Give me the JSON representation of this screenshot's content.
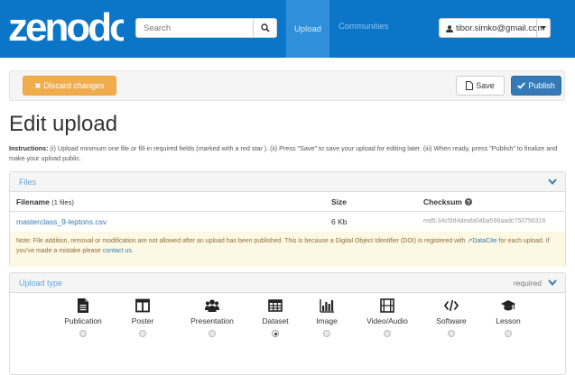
{
  "navbar": {
    "logo_text": "zenodo",
    "search_placeholder": "Search",
    "upload_label": "Upload",
    "communities_label": "Communities",
    "user_email": "tibor.simko@gmail.com"
  },
  "actions": {
    "discard_label": "Discard changes",
    "save_label": "Save",
    "publish_label": "Publish"
  },
  "page": {
    "title": "Edit upload",
    "instructions_label": "Instructions:",
    "instructions_text": " (i) Upload minimum one file or fill-in required fields (marked with a red star ). (ii) Press \"Save\" to save your upload for editing later. (iii) When ready, press \"Publish\" to finalize and make your upload public."
  },
  "files": {
    "panel_title": "Files",
    "col_filename": "Filename",
    "files_count": "(1 files)",
    "col_size": "Size",
    "col_checksum": "Checksum",
    "rows": [
      {
        "name": "masterclass_9-leptons.csv",
        "size": "6 Kb",
        "checksum": "md5:34c5fd4deafa04ba598aadc750756316"
      }
    ],
    "note_text": "Note: File addition, removal or modification are not allowed after an upload has been published. This is because a Digital Object Identifier (DOI) is registered with",
    "note_link": "DataCite",
    "note_text2": " for each upload. If you've made a mistake please",
    "note_contact": "contact us."
  },
  "upload_type": {
    "panel_title": "Upload type",
    "required_label": "required",
    "types": [
      {
        "label": "Publication",
        "icon": "file-icon",
        "selected": false
      },
      {
        "label": "Poster",
        "icon": "columns-icon",
        "selected": false
      },
      {
        "label": "Presentation",
        "icon": "group-icon",
        "selected": false
      },
      {
        "label": "Dataset",
        "icon": "table-icon",
        "selected": true
      },
      {
        "label": "Image",
        "icon": "bar-chart-icon",
        "selected": false
      },
      {
        "label": "Video/Audio",
        "icon": "film-icon",
        "selected": false
      },
      {
        "label": "Software",
        "icon": "code-icon",
        "selected": false
      },
      {
        "label": "Lesson",
        "icon": "graduation-cap-icon",
        "selected": false
      }
    ]
  },
  "colors": {
    "navbar_bg": "#0b75c8",
    "discard_bg": "#f0ad4e",
    "publish_bg": "#337ab7",
    "note_bg": "#fcf8e3"
  }
}
